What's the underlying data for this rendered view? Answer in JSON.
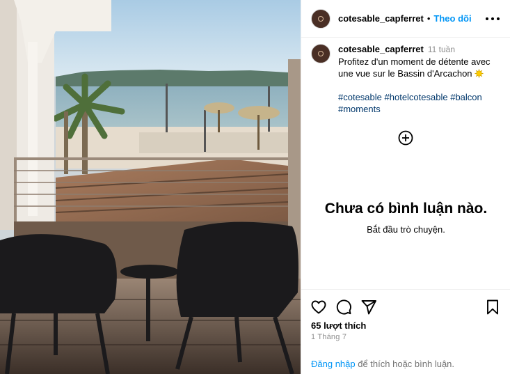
{
  "post": {
    "username": "cotesable_capferret",
    "separator": "•",
    "follow_label": "Theo dõi",
    "more_icon": "more-horizontal-icon",
    "photo_alt": "Balcon avec vue sur le Bassin d'Arcachon"
  },
  "caption": {
    "username": "cotesable_capferret",
    "time": "11 tuần",
    "text": "Profitez d'un moment de détente avec une vue sur le Bassin d'Arcachon",
    "emoji_icon": "sun-emoji-icon",
    "hashtags": [
      "#cotesable",
      "#hotelcotesable",
      "#balcon",
      "#moments"
    ]
  },
  "comments": {
    "add_icon": "add-circle-icon",
    "empty_title": "Chưa có bình luận nào.",
    "empty_subtitle": "Bắt đầu trò chuyện."
  },
  "actions": {
    "like_icon": "heart-icon",
    "comment_icon": "comment-icon",
    "share_icon": "send-icon",
    "save_icon": "bookmark-icon",
    "likes": "65 lượt thích",
    "date": "1 Tháng 7",
    "login_link": "Đăng nhập",
    "login_suffix": " để thích hoặc bình luận."
  },
  "colors": {
    "link_blue": "#0095f6",
    "hashtag": "#00376b",
    "muted": "#8e8e8e",
    "divider": "#efefef"
  }
}
